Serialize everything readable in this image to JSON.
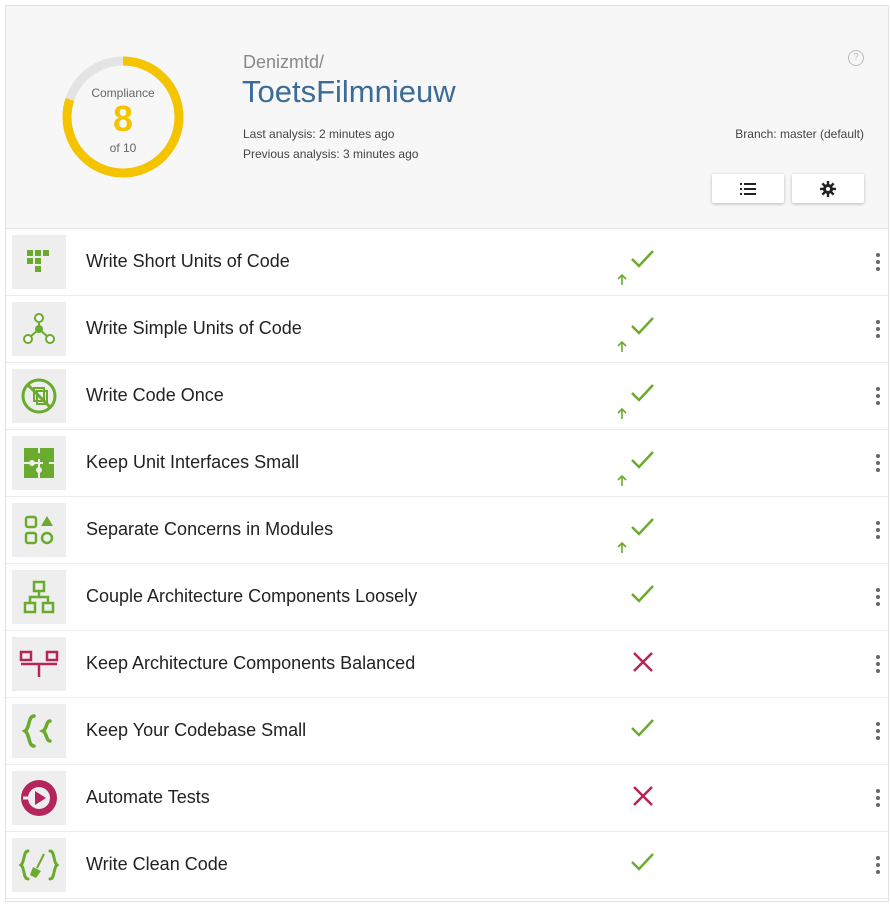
{
  "compliance": {
    "title": "Compliance",
    "score": "8",
    "of": "of 10",
    "fraction": 0.8
  },
  "repo": {
    "owner": "Denizmtd/",
    "name": "ToetsFilmnieuw",
    "last_analysis": "Last analysis: 2 minutes ago",
    "previous_analysis": "Previous analysis: 3 minutes ago",
    "branch": "Branch: master (default)"
  },
  "toolbar": {
    "list_icon": "list-icon",
    "settings_icon": "gear-icon"
  },
  "colors": {
    "accent": "#f5c400",
    "pass": "#6aab2e",
    "fail": "#b5245a",
    "repo_link": "#3d6b98"
  },
  "guidelines": [
    {
      "label": "Write Short Units of Code",
      "status": "pass",
      "improved": true,
      "icon": "blocks-icon"
    },
    {
      "label": "Write Simple Units of Code",
      "status": "pass",
      "improved": true,
      "icon": "graph-nodes-icon"
    },
    {
      "label": "Write Code Once",
      "status": "pass",
      "improved": true,
      "icon": "no-copy-icon"
    },
    {
      "label": "Keep Unit Interfaces Small",
      "status": "pass",
      "improved": true,
      "icon": "puzzle-icon"
    },
    {
      "label": "Separate Concerns in Modules",
      "status": "pass",
      "improved": true,
      "icon": "modules-icon"
    },
    {
      "label": "Couple Architecture Components Loosely",
      "status": "pass",
      "improved": false,
      "icon": "components-icon"
    },
    {
      "label": "Keep Architecture Components Balanced",
      "status": "fail",
      "improved": false,
      "icon": "balance-icon"
    },
    {
      "label": "Keep Your Codebase Small",
      "status": "pass",
      "improved": false,
      "icon": "braces-icon"
    },
    {
      "label": "Automate Tests",
      "status": "fail",
      "improved": false,
      "icon": "play-test-icon"
    },
    {
      "label": "Write Clean Code",
      "status": "pass",
      "improved": false,
      "icon": "broom-braces-icon"
    }
  ]
}
